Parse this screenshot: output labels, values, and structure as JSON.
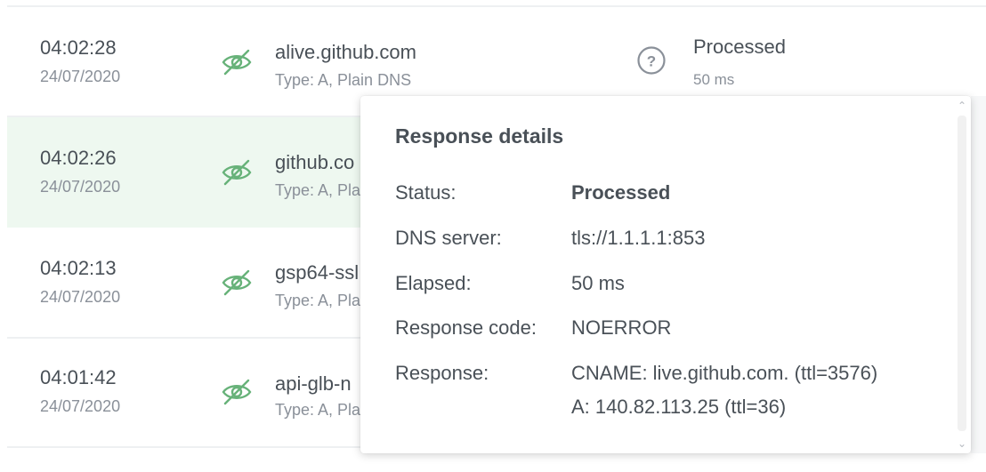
{
  "rows": [
    {
      "time": "04:02:28",
      "date": "24/07/2020",
      "domain": "alive.github.com",
      "type": "Type: A, Plain DNS",
      "status": "Processed",
      "elapsed": "50 ms"
    },
    {
      "time": "04:02:26",
      "date": "24/07/2020",
      "domain": "github.co",
      "type": "Type: A, Plai"
    },
    {
      "time": "04:02:13",
      "date": "24/07/2020",
      "domain": "gsp64-ssl",
      "type": "Type: A, Plai"
    },
    {
      "time": "04:01:42",
      "date": "24/07/2020",
      "domain": "api-glb-n",
      "type": "Type: A, Pla"
    }
  ],
  "popover": {
    "title": "Response details",
    "status_label": "Status:",
    "status_value": "Processed",
    "server_label": "DNS server:",
    "server_value": "tls://1.1.1.1:853",
    "elapsed_label": "Elapsed:",
    "elapsed_value": "50 ms",
    "code_label": "Response code:",
    "code_value": "NOERROR",
    "response_label": "Response:",
    "response_lines": [
      "CNAME: live.github.com. (ttl=3576)",
      "A: 140.82.113.25 (ttl=36)"
    ]
  },
  "colors": {
    "accent": "#67b279",
    "highlight": "#eef8f0"
  },
  "icons": {
    "row_icon": "eye-slash-icon",
    "status_icon": "question-circle-icon"
  }
}
